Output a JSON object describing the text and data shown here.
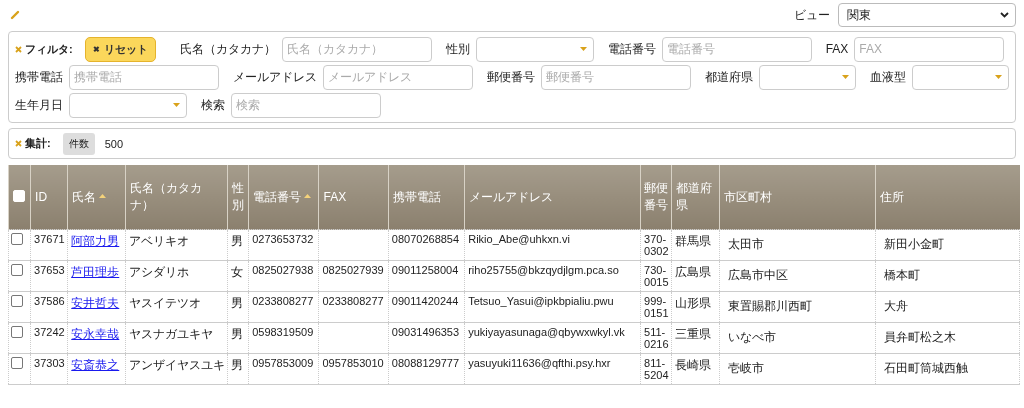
{
  "view": {
    "label": "ビュー",
    "value": "関東"
  },
  "filter": {
    "title": "フィルタ:",
    "reset_icon": "✖",
    "reset": "リセット",
    "rows": [
      {
        "fields": [
          {
            "label": "氏名（カタカナ）",
            "kind": "text",
            "placeholder": "氏名（カタカナ）"
          },
          {
            "label": "性別",
            "kind": "select"
          },
          {
            "label": "電話番号",
            "kind": "text",
            "placeholder": "電話番号"
          },
          {
            "label": "FAX",
            "kind": "text",
            "placeholder": "FAX"
          }
        ]
      },
      {
        "fields": [
          {
            "label": "携帯電話",
            "kind": "text",
            "placeholder": "携帯電話"
          },
          {
            "label": "メールアドレス",
            "kind": "text",
            "placeholder": "メールアドレス"
          },
          {
            "label": "郵便番号",
            "kind": "text",
            "placeholder": "郵便番号"
          },
          {
            "label": "都道府県",
            "kind": "select"
          },
          {
            "label": "血液型",
            "kind": "select"
          }
        ]
      },
      {
        "fields": [
          {
            "label": "生年月日",
            "kind": "select"
          },
          {
            "label": "検索",
            "kind": "text",
            "placeholder": "検索"
          }
        ]
      }
    ]
  },
  "summary": {
    "title": "集計:",
    "tag": "件数",
    "value": "500"
  },
  "table": {
    "select_all_checked": false,
    "columns": [
      {
        "label": "ID",
        "sorted": false
      },
      {
        "label": "氏名",
        "sorted": true
      },
      {
        "label": "氏名（カタカナ）",
        "sorted": false
      },
      {
        "label": "性別",
        "sorted": false
      },
      {
        "label": "電話番号",
        "sorted": true
      },
      {
        "label": "FAX",
        "sorted": false
      },
      {
        "label": "携帯電話",
        "sorted": false
      },
      {
        "label": "メールアドレス",
        "sorted": false
      },
      {
        "label": "郵便番号",
        "sorted": false
      },
      {
        "label": "都道府県",
        "sorted": false
      },
      {
        "label": "市区町村",
        "sorted": false
      },
      {
        "label": "住所",
        "sorted": false
      }
    ],
    "rows": [
      {
        "checked": false,
        "cells": [
          "37671",
          "阿部力男",
          "アベリキオ",
          "男",
          "0273653732",
          "",
          "08070268854",
          "Rikio_Abe@uhkxn.vi",
          "370-0302",
          "群馬県",
          "太田市",
          "新田小金町"
        ]
      },
      {
        "checked": false,
        "cells": [
          "37653",
          "芦田理歩",
          "アシダリホ",
          "女",
          "0825027938",
          "0825027939",
          "09011258004",
          "riho25755@bkzqydjlgm.pca.so",
          "730-0015",
          "広島県",
          "広島市中区",
          "橋本町"
        ]
      },
      {
        "checked": false,
        "cells": [
          "37586",
          "安井哲夫",
          "ヤスイテツオ",
          "男",
          "0233808277",
          "0233808277",
          "09011420244",
          "Tetsuo_Yasui@ipkbpialiu.pwu",
          "999-0151",
          "山形県",
          "東置賜郡川西町",
          "大舟"
        ]
      },
      {
        "checked": false,
        "cells": [
          "37242",
          "安永幸哉",
          "ヤスナガユキヤ",
          "男",
          "0598319509",
          "",
          "09031496353",
          "yukiyayasunaga@qbywxwkyl.vk",
          "511-0216",
          "三重県",
          "いなべ市",
          "員弁町松之木"
        ]
      },
      {
        "checked": false,
        "cells": [
          "37303",
          "安斎恭之",
          "アンザイヤスユキ",
          "男",
          "0957853009",
          "0957853010",
          "08088129777",
          "yasuyuki11636@qfthi.psy.hxr",
          "811-5204",
          "長崎県",
          "壱岐市",
          "石田町筒城西触"
        ]
      }
    ]
  }
}
